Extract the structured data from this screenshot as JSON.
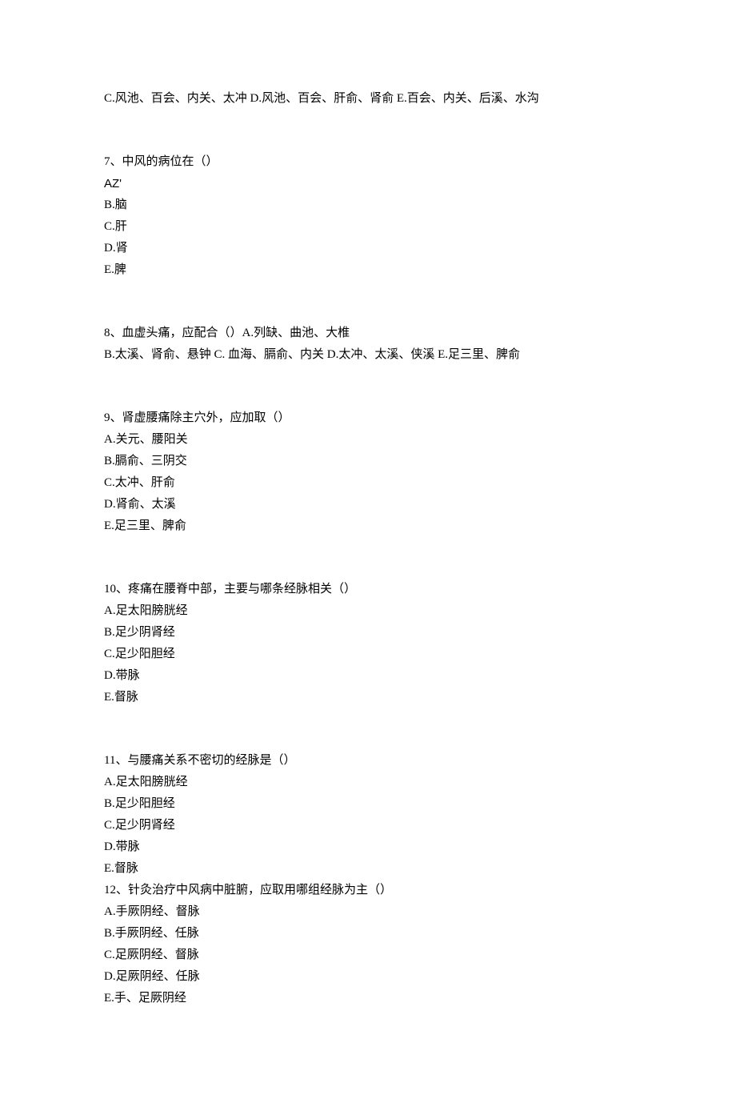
{
  "q6_remainder": "C.风池、百会、内关、太冲 D.风池、百会、肝俞、肾俞 E.百会、内关、后溪、水沟",
  "q7": {
    "stem": "7、中风的病位在（）",
    "a": "AZ'",
    "b": "B.脑",
    "c": "C.肝",
    "d": "D.肾",
    "e": "E.脾"
  },
  "q8": {
    "line1": "8、血虚头痛，应配合（）A.列缺、曲池、大椎",
    "line2": "B.太溪、肾俞、悬钟 C. 血海、膈俞、内关 D.太冲、太溪、侠溪 E.足三里、脾俞"
  },
  "q9": {
    "stem": "9、肾虚腰痛除主穴外，应加取（）",
    "a": "A.关元、腰阳关",
    "b": "B.膈俞、三阴交",
    "c": "C.太冲、肝俞",
    "d": "D.肾俞、太溪",
    "e": "E.足三里、脾俞"
  },
  "q10": {
    "stem": "10、疼痛在腰脊中部，主要与哪条经脉相关（）",
    "a": "A.足太阳膀胱经",
    "b": "B.足少阴肾经",
    "c": "C.足少阳胆经",
    "d": "D.带脉",
    "e": "E.督脉"
  },
  "q11": {
    "stem": "11、与腰痛关系不密切的经脉是（）",
    "a": "A.足太阳膀胱经",
    "b": "B.足少阳胆经",
    "c": "C.足少阴肾经",
    "d": "D.带脉",
    "e": "E.督脉"
  },
  "q12": {
    "stem": "12、针灸治疗中风病中脏腑，应取用哪组经脉为主（）",
    "a": "A.手厥阴经、督脉",
    "b": "B.手厥阴经、任脉",
    "c": "C.足厥阴经、督脉",
    "d": "D.足厥阴经、任脉",
    "e": "E.手、足厥阴经"
  }
}
